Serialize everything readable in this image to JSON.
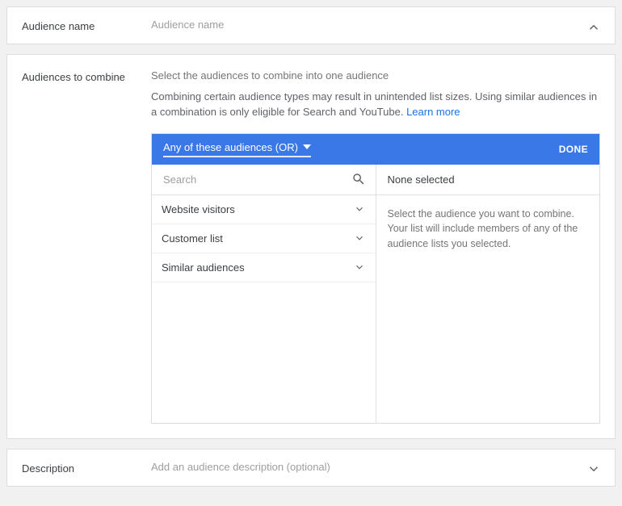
{
  "audience_name_section": {
    "label": "Audience name",
    "placeholder": "Audience name"
  },
  "combine_section": {
    "label": "Audiences to combine",
    "intro": "Select the audiences to combine into one audience",
    "disclaimer": "Combining certain audience types may result in unintended list sizes. Using similar audiences in a combination is only eligible for Search and YouTube. ",
    "learn_more": "Learn more"
  },
  "picker": {
    "type_label": "Any of these audiences (OR)",
    "done_label": "DONE",
    "search_placeholder": "Search",
    "categories": [
      {
        "label": "Website visitors"
      },
      {
        "label": "Customer list"
      },
      {
        "label": "Similar audiences"
      }
    ],
    "right_header": "None selected",
    "right_help": "Select the audience you want to combine. Your list will include members of any of the audience lists you selected."
  },
  "description_section": {
    "label": "Description",
    "placeholder": "Add an audience description (optional)"
  }
}
